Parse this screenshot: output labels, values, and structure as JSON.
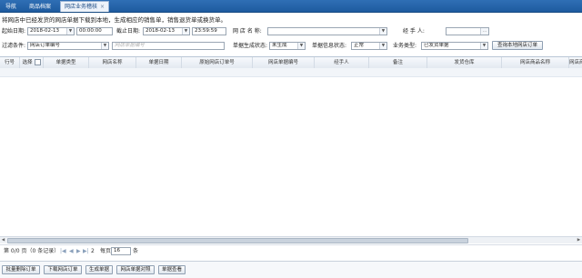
{
  "tabs": [
    {
      "label": "导航",
      "active": false
    },
    {
      "label": "商品档案",
      "active": false
    },
    {
      "label": "网店业务稽核",
      "active": true
    }
  ],
  "notice": "将网店中已经发货的网店单据下载到本地，生成相应的销售单，销售退货单或换货单。",
  "filters": {
    "start_date_label": "起始日期:",
    "start_date": "2018-02-13",
    "start_time": "00:00:00",
    "end_date_label": "截止日期:",
    "end_date": "2018-02-13",
    "end_time": "23:59:59",
    "shop_name_label": "网 店 名 称:",
    "shop_name": "",
    "handler_label": "经 手 人:",
    "handler": "",
    "filter_label": "过滤条件:",
    "filter_value": "网店订单编号",
    "filter_placeholder": "网店单据编号",
    "gen_status_label": "单据生成状态:",
    "gen_status": "未生成",
    "info_status_label": "单据信息状态:",
    "info_status": "正常",
    "biz_type_label": "业务类型:",
    "biz_type": "已发货单据",
    "query_button": "查询本地网店订单"
  },
  "grid": {
    "columns": [
      "行号",
      "选择",
      "单据类型",
      "网店名称",
      "单据日期",
      "原始网店订单号",
      "网店单据编号",
      "经手人",
      "备注",
      "发货仓库",
      "网店商品名称",
      "网店商"
    ]
  },
  "pager": {
    "summary": "第 0/0 页（0 条记录）",
    "first_icon": "first-page-icon",
    "prev_icon": "prev-page-icon",
    "next_icon": "next-page-icon",
    "last_icon": "last-page-icon",
    "page_input": "2",
    "per_page_label": "每页",
    "page_size": "16",
    "unit": "条"
  },
  "actions": [
    "批量删除订单",
    "下载网店订单",
    "生成单据",
    "网店单据对照",
    "单据查看"
  ],
  "colors": {
    "tabbar": "#1e5b9f",
    "accent": "#2f6fb5"
  }
}
